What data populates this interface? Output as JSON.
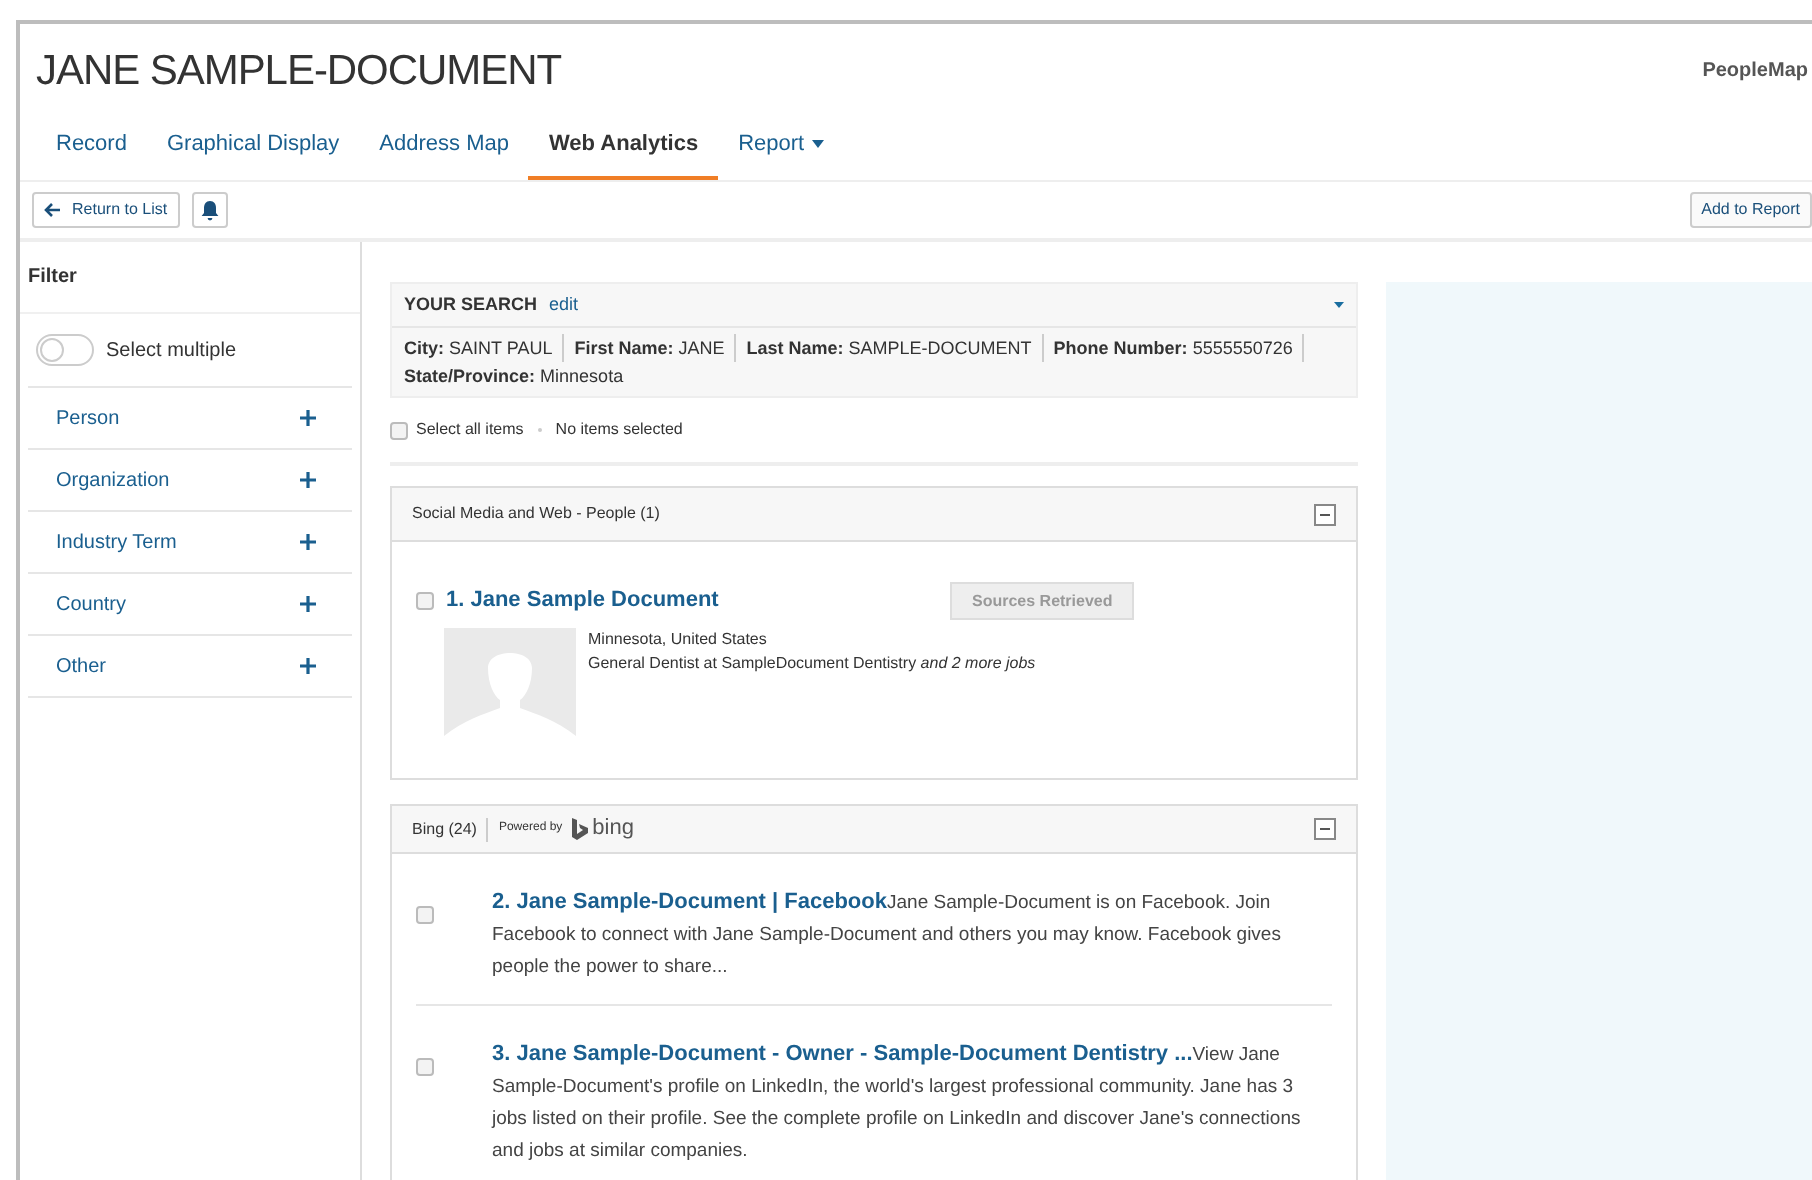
{
  "header": {
    "title": "JANE SAMPLE-DOCUMENT",
    "brand": "PeopleMap"
  },
  "tabs": [
    {
      "label": "Record",
      "selected": false,
      "has_menu": false
    },
    {
      "label": "Graphical Display",
      "selected": false,
      "has_menu": false
    },
    {
      "label": "Address Map",
      "selected": false,
      "has_menu": false
    },
    {
      "label": "Web Analytics",
      "selected": true,
      "has_menu": false
    },
    {
      "label": "Report",
      "selected": false,
      "has_menu": true
    }
  ],
  "toolbar": {
    "back_button": "Return to List",
    "add_button": "Add to Report"
  },
  "filter": {
    "title": "Filter",
    "toggle": {
      "label": "Select multiple",
      "on": false
    },
    "items": [
      {
        "label": "Person",
        "expanded": false
      },
      {
        "label": "Organization",
        "expanded": false
      },
      {
        "label": "Industry Term",
        "expanded": false
      },
      {
        "label": "Country",
        "expanded": false
      },
      {
        "label": "Other",
        "expanded": false
      }
    ]
  },
  "search": {
    "title": "YOUR SEARCH",
    "edit": "edit",
    "criteria": [
      {
        "label": "City:",
        "value": "SAINT PAUL"
      },
      {
        "label": "First Name:",
        "value": "JANE"
      },
      {
        "label": "Last Name:",
        "value": "SAMPLE-DOCUMENT"
      },
      {
        "label": "Phone Number:",
        "value": "5555550726"
      },
      {
        "label": "State/Province:",
        "value": "Minnesota"
      }
    ]
  },
  "selection": {
    "select_all": "Select all items",
    "checked": false,
    "status": "No items selected"
  },
  "people_section": {
    "title": "Social Media and Web - People (1)",
    "results": [
      {
        "title": "1. Jane Sample Document",
        "checked": false,
        "status_button": "Sources Retrieved",
        "location": "Minnesota, United States",
        "job": "General Dentist at SampleDocument Dentistry *and 2 more jobs*"
      }
    ]
  },
  "bing_section": {
    "title": "Bing (24)",
    "powered_by": "Powered by",
    "logo_text": "bing",
    "results": [
      {
        "number": "2.",
        "title": "Jane Sample-Document | Facebook",
        "checked": false,
        "snippet": "Jane Sample-Document is on Facebook. Join Facebook to connect with Jane Sample-Document and others you may know. Facebook gives people the power to share..."
      },
      {
        "number": "3.",
        "title": "Jane Sample-Document - Owner - Sample-Document Dentistry ...",
        "checked": false,
        "snippet": "View Jane Sample-Document's profile on LinkedIn, the world's largest professional community. Jane has 3 jobs listed on their profile. See the complete profile on LinkedIn and discover Jane's connections and jobs at similar companies."
      }
    ]
  }
}
